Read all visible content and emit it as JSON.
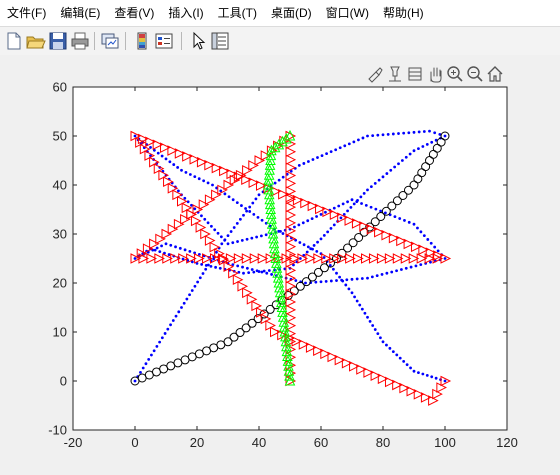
{
  "menubar": {
    "items": [
      {
        "label": "文件(F)"
      },
      {
        "label": "编辑(E)"
      },
      {
        "label": "查看(V)"
      },
      {
        "label": "插入(I)"
      },
      {
        "label": "工具(T)"
      },
      {
        "label": "桌面(D)"
      },
      {
        "label": "窗口(W)"
      },
      {
        "label": "帮助(H)"
      }
    ]
  },
  "toolbar": {
    "icons": [
      "new-figure-icon",
      "open-file-icon",
      "save-icon",
      "print-icon",
      "link-plot-icon",
      "insert-colorbar-icon",
      "insert-legend-icon",
      "pointer-icon",
      "property-inspector-icon"
    ]
  },
  "axes_toolbar": {
    "icons": [
      "brush-icon",
      "datatip-icon",
      "restore-view-icon",
      "pan-hand-icon",
      "zoom-in-icon",
      "zoom-out-icon",
      "home-icon"
    ]
  },
  "chart_data": {
    "type": "scatter",
    "xlim": [
      -20,
      120
    ],
    "ylim": [
      -10,
      60
    ],
    "xticks": [
      -20,
      0,
      20,
      40,
      60,
      80,
      100,
      120
    ],
    "yticks": [
      -10,
      0,
      10,
      20,
      30,
      40,
      50,
      60
    ],
    "grid": false,
    "colors": {
      "red": "#ff0000",
      "black": "#000000",
      "green": "#00ff00",
      "blue": "#0000ff"
    },
    "series": [
      {
        "marker": "triangle-right",
        "color": "#ff0000",
        "waypoints": [
          [
            50,
            0
          ],
          [
            50,
            50
          ],
          [
            0,
            25
          ],
          [
            100,
            25
          ],
          [
            0,
            50
          ],
          [
            45,
            10
          ],
          [
            96,
            -4
          ],
          [
            100,
            0
          ]
        ]
      },
      {
        "marker": "circle",
        "color": "#000000",
        "waypoints": [
          [
            0,
            0
          ],
          [
            30,
            8
          ],
          [
            65,
            25
          ],
          [
            90,
            40
          ],
          [
            100,
            50
          ]
        ]
      },
      {
        "marker": "triangle-up",
        "color": "#00ff00",
        "waypoints": [
          [
            50,
            0
          ],
          [
            48,
            12
          ],
          [
            45,
            27
          ],
          [
            43,
            40
          ],
          [
            44,
            47
          ],
          [
            50,
            50
          ]
        ]
      },
      {
        "marker": "dot",
        "color": "#0000ff",
        "waypoints": [
          [
            0,
            0
          ],
          [
            15,
            15
          ],
          [
            28,
            28
          ],
          [
            40,
            38
          ],
          [
            53,
            44
          ],
          [
            75,
            50
          ],
          [
            95,
            51
          ],
          [
            100,
            50
          ],
          [
            90,
            47
          ],
          [
            75,
            39
          ],
          [
            60,
            29
          ],
          [
            50,
            23
          ],
          [
            35,
            22
          ],
          [
            20,
            24
          ],
          [
            5,
            27
          ],
          [
            0,
            25
          ],
          [
            10,
            28
          ],
          [
            30,
            24
          ],
          [
            55,
            20
          ],
          [
            75,
            21
          ],
          [
            100,
            25
          ],
          [
            90,
            32
          ],
          [
            70,
            37
          ],
          [
            50,
            31
          ],
          [
            30,
            28
          ],
          [
            15,
            38
          ],
          [
            0,
            50
          ],
          [
            15,
            43
          ],
          [
            25,
            40
          ],
          [
            45,
            31
          ],
          [
            60,
            26
          ],
          [
            70,
            18
          ],
          [
            80,
            8
          ],
          [
            90,
            2
          ],
          [
            100,
            0
          ]
        ]
      }
    ]
  }
}
